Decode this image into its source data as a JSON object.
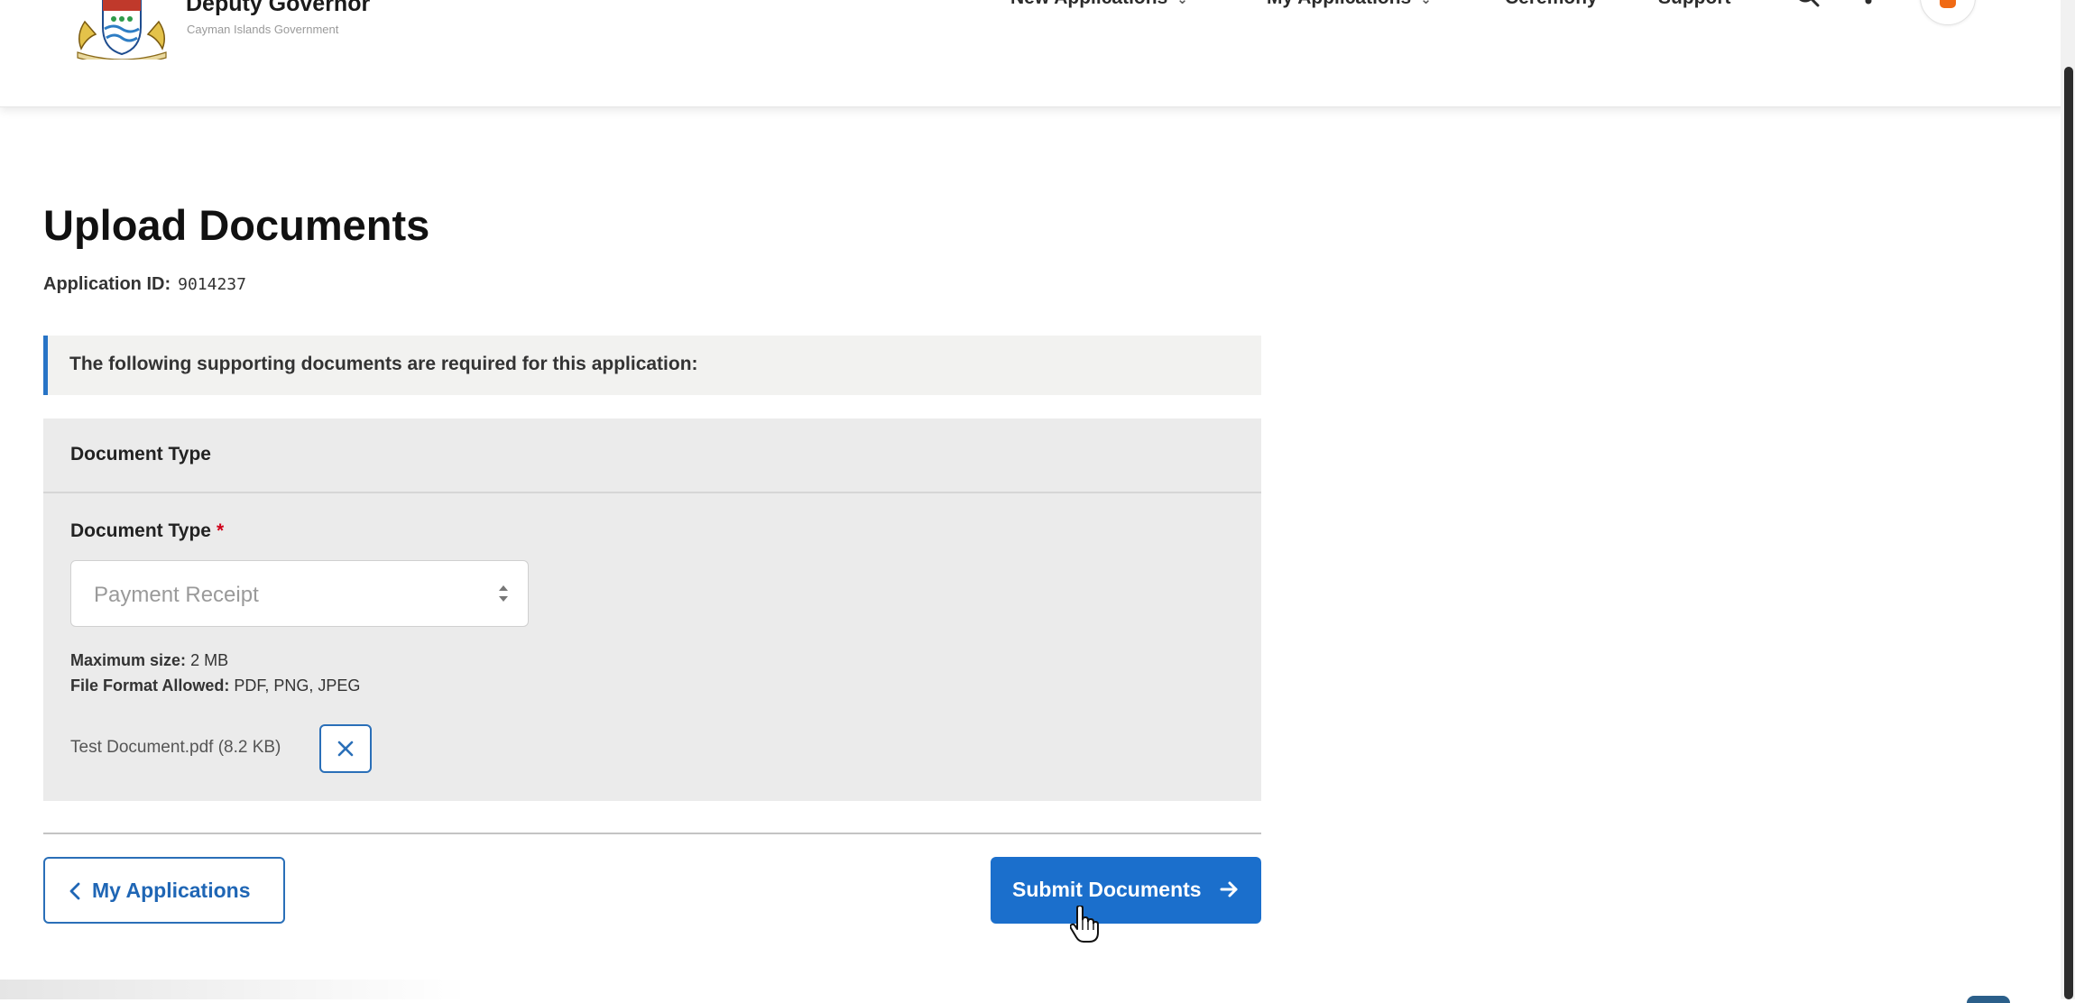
{
  "header": {
    "org_name": "Deputy Governor",
    "org_sub": "Cayman Islands Government",
    "nav": [
      {
        "label": "New Applications",
        "has_dropdown": true
      },
      {
        "label": "My Applications",
        "has_dropdown": true
      },
      {
        "label": "Ceremony",
        "has_dropdown": false
      },
      {
        "label": "Support",
        "has_dropdown": false
      }
    ],
    "icons": [
      "search-icon",
      "bell-icon",
      "user-avatar"
    ]
  },
  "page": {
    "title": "Upload Documents",
    "app_id_label": "Application ID:",
    "app_id_value": "9014237"
  },
  "notice": {
    "text": "The following supporting documents are required for this application:"
  },
  "document_section": {
    "header": "Document Type",
    "field_label": "Document Type",
    "required_mark": "*",
    "selected_value": "Payment Receipt",
    "max_size_label": "Maximum size:",
    "max_size_value": "2 MB",
    "formats_label": "File Format Allowed:",
    "formats_value": "PDF, PNG, JPEG",
    "uploaded_file": "Test Document.pdf (8.2 KB)"
  },
  "actions": {
    "back_label": "My Applications",
    "submit_label": "Submit Documents"
  },
  "colors": {
    "primary": "#1b6fcc",
    "outline": "#2a6fb8",
    "panel_bg": "#ebebeb",
    "notice_bg": "#f2f2f0",
    "required": "#d0021b",
    "avatar_accent": "#f06a14"
  }
}
